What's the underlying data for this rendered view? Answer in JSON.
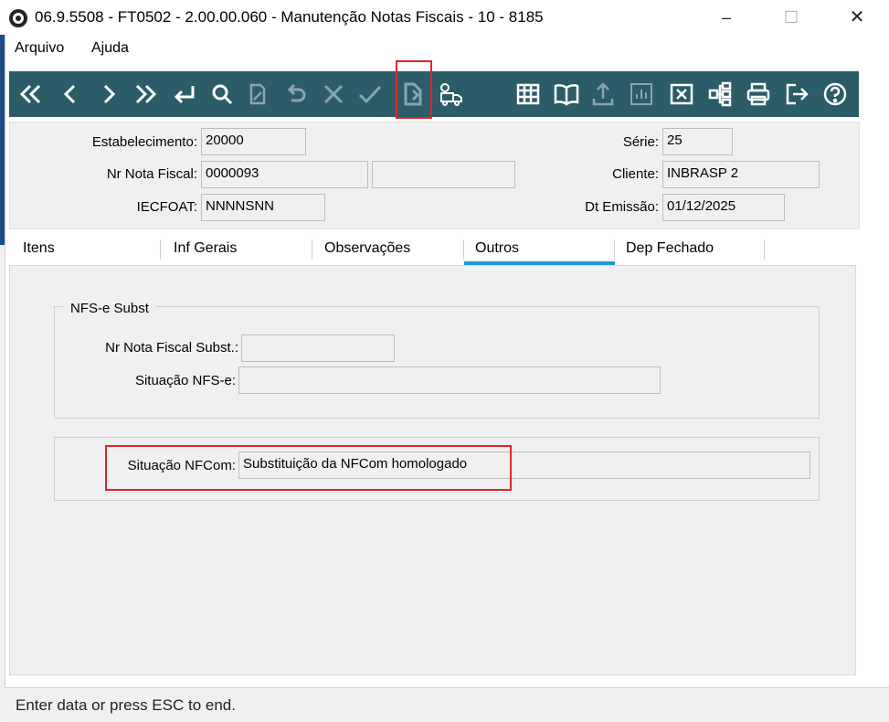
{
  "window": {
    "title": "06.9.5508 - FT0502 - 2.00.00.060 - Manutenção Notas Fiscais - 10 - 8185",
    "minimize": "–",
    "maximize": "☐",
    "close": "✕"
  },
  "menu": {
    "items": [
      "Arquivo",
      "Ajuda"
    ]
  },
  "toolbar": {
    "buttons": [
      "first-record-icon",
      "previous-record-icon",
      "next-record-icon",
      "last-record-icon",
      "goto-icon",
      "search-icon",
      "edit-icon",
      "undo-icon",
      "cancel-icon",
      "confirm-icon",
      "document-icon",
      "delivery-truck-icon",
      "table-icon",
      "book-icon",
      "upload-icon",
      "chart-icon",
      "delete-icon",
      "tree-icon",
      "print-icon",
      "exit-icon",
      "help-icon"
    ],
    "accent_color": "#2c5c68",
    "highlight_color": "#e1242a"
  },
  "header": {
    "estabelecimento_label": "Estabelecimento:",
    "estabelecimento_value": "20000",
    "nr_nota_label": "Nr Nota Fiscal:",
    "nr_nota_value": "0000093",
    "nr_nota_extra_value": "",
    "iecfoat_label": "IECFOAT:",
    "iecfoat_value": "NNNNSNN",
    "serie_label": "Série:",
    "serie_value": "25",
    "cliente_label": "Cliente:",
    "cliente_value": "INBRASP  2",
    "dt_emissao_label": "Dt Emissão:",
    "dt_emissao_value": "01/12/2025"
  },
  "tabs": {
    "items": [
      "Itens",
      "Inf Gerais",
      "Observações",
      "Outros",
      "Dep Fechado"
    ],
    "active": "Outros",
    "active_color": "#1e9ad6"
  },
  "outros": {
    "nfse_group_title": "NFS-e Subst",
    "nr_nota_subst_label": "Nr Nota Fiscal Subst.:",
    "nr_nota_subst_value": "",
    "situacao_nfse_label": "Situação NFS-e:",
    "situacao_nfse_value": "",
    "situacao_nfcom_label": "Situação NFCom:",
    "situacao_nfcom_value": "Substituição da NFCom homologado"
  },
  "status": {
    "text": "Enter data or press ESC to end."
  }
}
